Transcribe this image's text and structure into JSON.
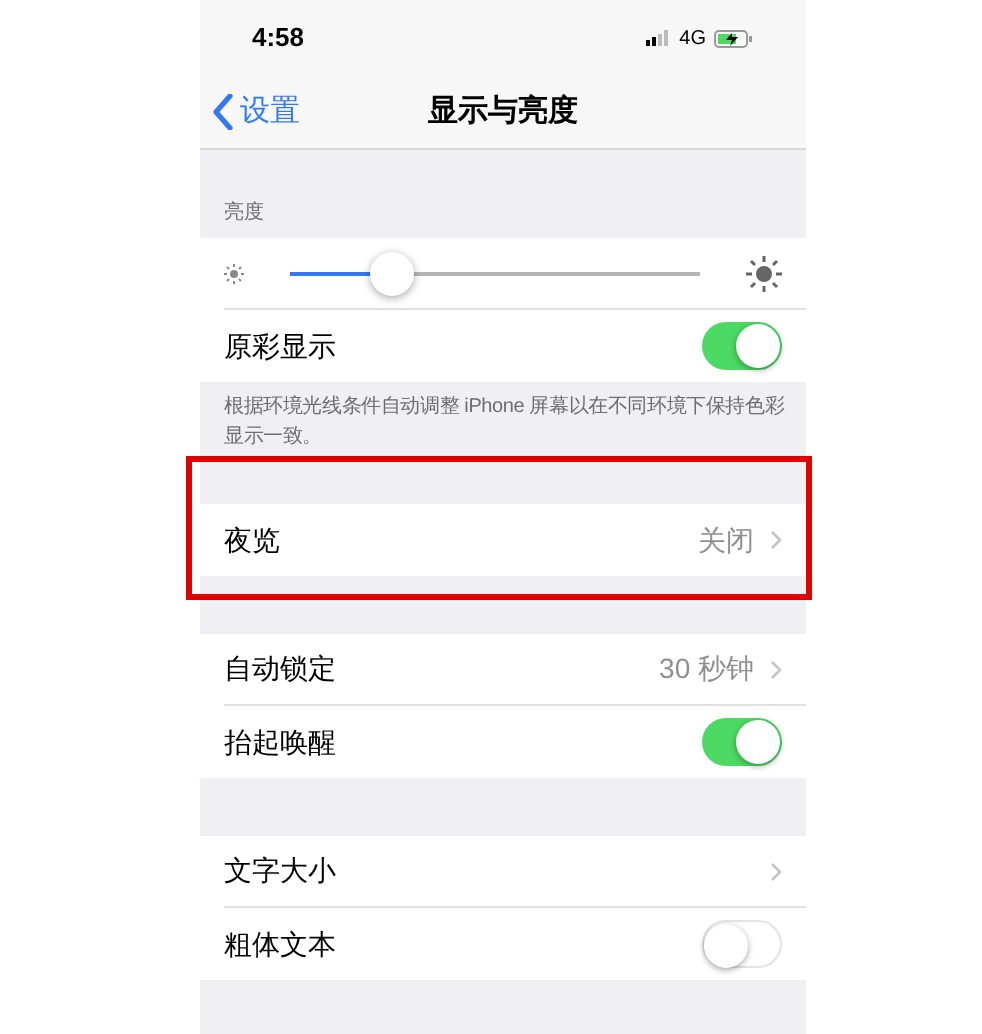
{
  "status_bar": {
    "time": "4:58",
    "network": "4G"
  },
  "nav": {
    "back": "设置",
    "title": "显示与亮度"
  },
  "sections": [
    {
      "header": "亮度",
      "rows": [
        {
          "kind": "slider",
          "level": 0.25
        },
        {
          "kind": "toggle",
          "label": "原彩显示",
          "on": true
        }
      ],
      "footer": "根据环境光线条件自动调整 iPhone 屏幕以在不同环境下保持色彩显示一致。"
    },
    {
      "highlighted": true,
      "rows": [
        {
          "kind": "link",
          "label": "夜览",
          "value": "关闭"
        }
      ]
    },
    {
      "highlighted": false,
      "rows": [
        {
          "kind": "link",
          "label": "自动锁定",
          "value": "30 秒钟"
        },
        {
          "kind": "toggle",
          "label": "抬起唤醒",
          "on": true
        }
      ]
    },
    {
      "highlighted": false,
      "rows": [
        {
          "kind": "link",
          "label": "文字大小"
        },
        {
          "kind": "toggle",
          "label": "粗体文本",
          "on": false
        }
      ]
    }
  ]
}
